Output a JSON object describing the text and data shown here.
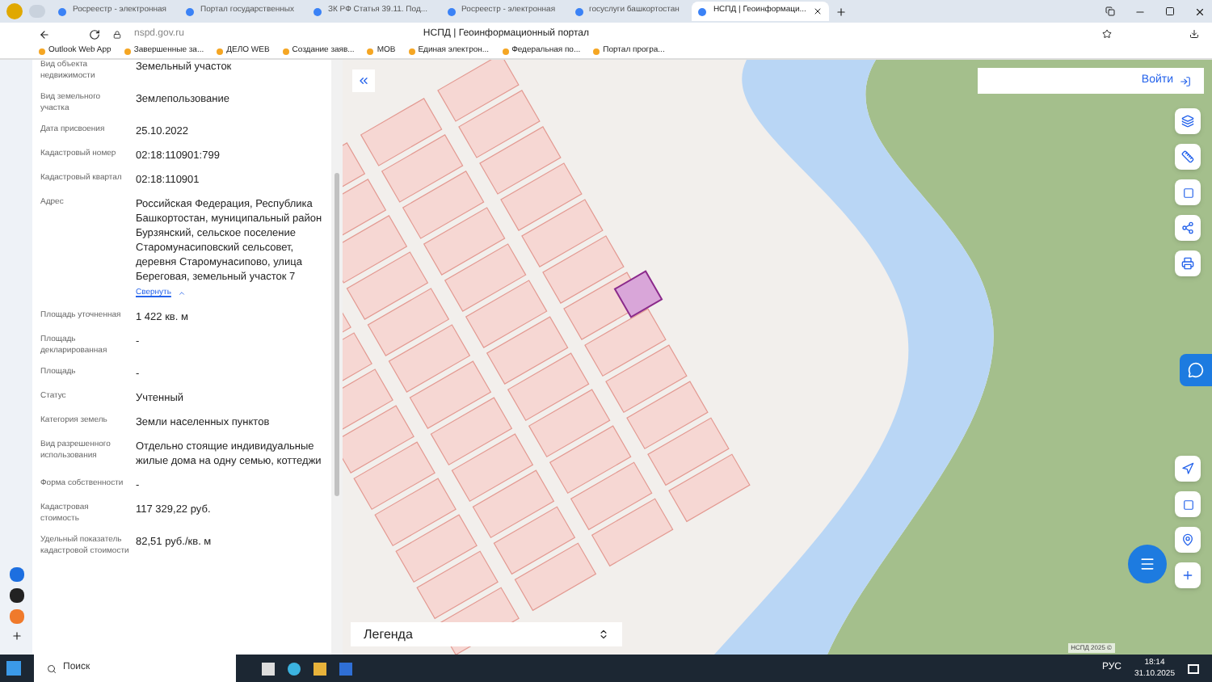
{
  "browser": {
    "tabs": [
      {
        "label": "Росреестр - электронная",
        "selected": false
      },
      {
        "label": "Портал государственных",
        "selected": false
      },
      {
        "label": "ЗК РФ Статья 39.11. Под...",
        "selected": false
      },
      {
        "label": "Росреестр - электронная",
        "selected": false
      },
      {
        "label": "госуслуги башкортостан",
        "selected": false
      },
      {
        "label": "НСПД | Геоинформаци...",
        "selected": true
      }
    ],
    "address": "nspd.gov.ru",
    "page_title": "НСПД | Геоинформационный портал",
    "bookmarks": [
      "Outlook Web App",
      "Завершенные за...",
      "ДЕЛО WEB",
      "Создание заяв...",
      "МОВ",
      "Единая электрон...",
      "Федеральная по...",
      "Портал програ..."
    ]
  },
  "panel": {
    "rows": [
      {
        "label": "Вид объекта недвижимости",
        "value": "Земельный участок"
      },
      {
        "label": "Вид земельного участка",
        "value": "Землепользование"
      },
      {
        "label": "Дата присвоения",
        "value": "25.10.2022"
      },
      {
        "label": "Кадастровый номер",
        "value": "02:18:110901:799"
      },
      {
        "label": "Кадастровый квартал",
        "value": "02:18:110901"
      },
      {
        "label": "Адрес",
        "value": "Российская Федерация, Республика Башкортостан, муниципальный район Бурзянский, сельское поселение Старомунасиповский сельсовет, деревня Старомунасипово, улица Береговая, земельный участок 7",
        "link": "Свернуть"
      },
      {
        "label": "Площадь уточненная",
        "value": "1 422 кв. м"
      },
      {
        "label": "Площадь декларированная",
        "value": "-"
      },
      {
        "label": "Площадь",
        "value": "-"
      },
      {
        "label": "Статус",
        "value": "Учтенный"
      },
      {
        "label": "Категория земель",
        "value": "Земли населенных пунктов"
      },
      {
        "label": "Вид разрешенного использования",
        "value": "Отдельно стоящие индивидуальные жилые дома на одну семью, коттеджи"
      },
      {
        "label": "Форма собственности",
        "value": "-"
      },
      {
        "label": "Кадастровая стоимость",
        "value": "117 329,22 руб."
      },
      {
        "label": "Удельный показатель кадастровой стоимости",
        "value": "82,51 руб./кв. м"
      }
    ]
  },
  "map": {
    "login": "Войти",
    "legend": "Легенда",
    "attribution": "НСПД 2025 ©"
  },
  "taskbar": {
    "search_placeholder": "Поиск",
    "lang": "РУС",
    "time": "18:14",
    "date": "31.10.2025"
  }
}
